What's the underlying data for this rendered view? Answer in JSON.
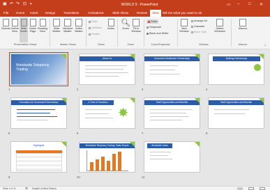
{
  "window": {
    "title": "WORLD 9 - PowerPoint"
  },
  "tabs": [
    "File",
    "Home",
    "Insert",
    "Design",
    "Transitions",
    "Animations",
    "Slide Show",
    "Review",
    "View"
  ],
  "active_tab": "View",
  "tell_me": "Tell me what you want to do",
  "ribbon": {
    "presentation_views": {
      "label": "Presentation Views",
      "buttons": [
        "Normal",
        "Outline View",
        "Slide Sorter",
        "Notes Page",
        "Reading View"
      ]
    },
    "master_views": {
      "label": "Master Views",
      "buttons": [
        "Slide Master",
        "Handout Master",
        "Notes Master"
      ]
    },
    "show": {
      "label": "Show",
      "options": [
        "Ruler",
        "Gridlines",
        "Guides"
      ],
      "notes": "Notes"
    },
    "zoom": {
      "label": "Zoom",
      "buttons": [
        "Zoom",
        "Fit to Window"
      ]
    },
    "color": {
      "label": "Color/Grayscale",
      "options": [
        "Color",
        "Grayscale",
        "Black and White"
      ]
    },
    "window_group": {
      "label": "Window",
      "new_window": "New Window",
      "options": [
        "Arrange All",
        "Cascade",
        "Move Split"
      ],
      "switch": "Switch Windows"
    },
    "macros": {
      "label": "Macros",
      "button": "Macros"
    }
  },
  "slides": [
    {
      "num": "1",
      "title": "Worldwide Telephony Trading"
    },
    {
      "num": "2",
      "title": "About Us"
    },
    {
      "num": "3",
      "title": "Successful Distribution Partnerships"
    },
    {
      "num": "4",
      "title": "Building Partnerships"
    },
    {
      "num": "5",
      "title": "Foundation for Successful Partnerships"
    },
    {
      "num": "6",
      "title": "A Time of Transition"
    },
    {
      "num": "7",
      "title": "Staff Opportunities and Benefits"
    },
    {
      "num": "8",
      "title": "Staff Opportunities and Benefits"
    },
    {
      "num": "9",
      "title": "Highlights"
    },
    {
      "num": "10",
      "title": "Worldwide Telephony Trading: Sales Report"
    },
    {
      "num": "11",
      "title": "Worldwide Sales"
    }
  ],
  "status": {
    "slide": "Slide 1 of 11",
    "language": "English (United States)"
  }
}
